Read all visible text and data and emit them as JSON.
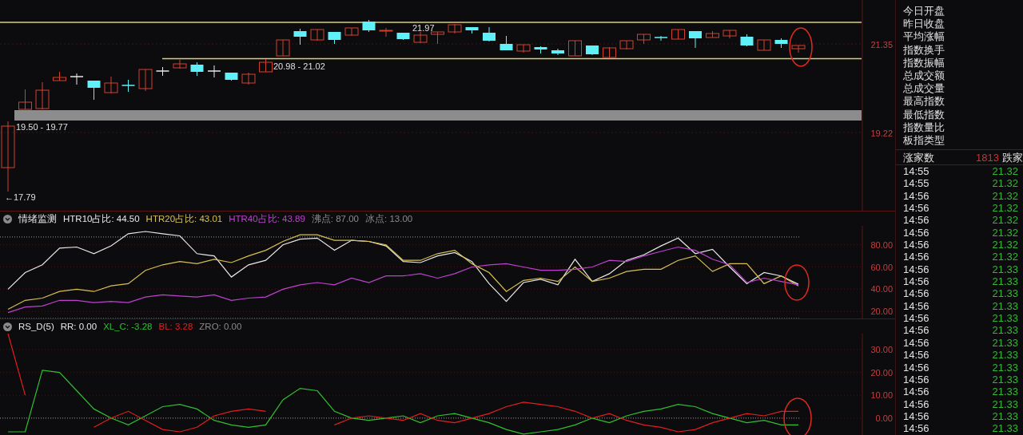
{
  "main_chart": {
    "annotations": [
      {
        "text": "21.97"
      },
      {
        "text": "20.98 - 21.02"
      },
      {
        "text": "19.50 - 19.77"
      },
      {
        "text": "←17.79"
      }
    ],
    "price_labels": [
      "21.35",
      "19.22"
    ]
  },
  "indicators": [
    {
      "title": "情绪监测",
      "legend": [
        {
          "kind": "series"
        },
        {
          "kind": "series"
        },
        {
          "kind": "series"
        },
        {
          "kind": "text",
          "text": "沸点: 87.00",
          "color": "#8a8a8a"
        },
        {
          "kind": "text",
          "text": "冰点: 13.00",
          "color": "#8a8a8a"
        }
      ],
      "chart_data": {
        "type": "line",
        "ylim": [
          13,
          97
        ],
        "grid": true,
        "yticks": [
          {
            "value": 20,
            "label": "20.00"
          },
          {
            "value": 40,
            "label": "40.00"
          },
          {
            "value": 60,
            "label": "60.00"
          },
          {
            "value": 80,
            "label": "80.00"
          }
        ],
        "ref_lines": [
          {
            "axis": "y",
            "value": 87
          },
          {
            "axis": "y",
            "value": 13
          }
        ],
        "series": [
          {
            "name": "HTR10占比: 44.50",
            "color": "#e8e8e8",
            "values": [
              40,
              55,
              62,
              77,
              78,
              72,
              79,
              90,
              92,
              90,
              88,
              72,
              70,
              51,
              62,
              66,
              80,
              85,
              86,
              75,
              84,
              83,
              79,
              65,
              64,
              70,
              73,
              65,
              45,
              29,
              46,
              49,
              44,
              67,
              47,
              54,
              66,
              71,
              79,
              86,
              72,
              76,
              60,
              45,
              55,
              52,
              44.5
            ]
          },
          {
            "name": "HTR20占比: 43.01",
            "color": "#d8c050",
            "values": [
              22,
              30,
              32,
              38,
              40,
              38,
              43,
              45,
              57,
              62,
              65,
              63,
              67,
              64,
              70,
              75,
              83,
              89,
              89,
              84,
              84,
              83,
              80,
              66,
              66,
              72,
              75,
              63,
              55,
              38,
              48,
              50,
              47,
              60,
              47,
              50,
              56,
              58,
              58,
              66,
              70,
              56,
              63,
              63,
              45,
              52,
              43
            ]
          },
          {
            "name": "HTR40占比: 43.89",
            "color": "#c040d0",
            "values": [
              19,
              24,
              25,
              30,
              30,
              28,
              29,
              28,
              33,
              35,
              34,
              33,
              35,
              30,
              32,
              33,
              40,
              44,
              46,
              44,
              50,
              46,
              52,
              52,
              54,
              50,
              54,
              60,
              62,
              63,
              60,
              57,
              57,
              58,
              60,
              66,
              65,
              70,
              74,
              78,
              75,
              67,
              62,
              46,
              50,
              47,
              44
            ]
          }
        ]
      }
    },
    {
      "title": "RS_D(5)",
      "legend": [
        {
          "kind": "text",
          "text": "RR: 0.00",
          "color": "#e8e8e8"
        },
        {
          "kind": "series"
        },
        {
          "kind": "series"
        },
        {
          "kind": "text",
          "text": "ZRO: 0.00",
          "color": "#8a8a8a"
        }
      ],
      "chart_data": {
        "type": "line",
        "ylim": [
          -7.4,
          37
        ],
        "grid": true,
        "yticks": [
          {
            "value": 0,
            "label": "0.00"
          },
          {
            "value": 10,
            "label": "10.00"
          },
          {
            "value": 20,
            "label": "20.00"
          },
          {
            "value": 30,
            "label": "30.00"
          }
        ],
        "ref_lines": [
          {
            "axis": "y",
            "value": 0
          }
        ],
        "series": [
          {
            "name": "XL_C: -3.28",
            "color": "#30c030",
            "values": [
              -6,
              -6,
              21,
              20,
              12,
              4,
              0,
              -3,
              1,
              5,
              6,
              4,
              -1,
              -3,
              -4,
              -3,
              8,
              13,
              12,
              3,
              0,
              -1,
              0,
              1,
              -2,
              1,
              2,
              0,
              -2,
              -5,
              -7,
              -6,
              -5,
              -3,
              0,
              -2,
              1,
              3,
              4,
              6,
              5,
              2,
              0,
              -2,
              -1,
              -3,
              -3
            ]
          },
          {
            "name": "BL: 3.28",
            "color": "#e02020",
            "values": [
              37,
              10,
              null,
              null,
              null,
              -4,
              0,
              3,
              -1,
              -5,
              -6,
              -4,
              1,
              3,
              4,
              3,
              null,
              null,
              null,
              -3,
              0,
              1,
              0,
              -1,
              2,
              -1,
              -2,
              0,
              2,
              5,
              7,
              6,
              5,
              3,
              0,
              2,
              -1,
              -3,
              -4,
              -6,
              -5,
              -2,
              0,
              2,
              1,
              3,
              3
            ]
          }
        ]
      }
    }
  ],
  "quote_panel": {
    "fields": [
      {
        "label": "今日开盘"
      },
      {
        "label": "昨日收盘"
      },
      {
        "label": "平均涨幅"
      },
      {
        "label": "指数换手"
      },
      {
        "label": "指数振幅"
      },
      {
        "label": "总成交额"
      },
      {
        "label": "总成交量"
      },
      {
        "label": "最高指数"
      },
      {
        "label": "最低指数"
      },
      {
        "label": "指数量比"
      },
      {
        "label": "板指类型"
      }
    ],
    "advance": {
      "label": "涨家数",
      "value": "1813",
      "next_label": "跌家"
    }
  },
  "ticks": [
    {
      "time": "14:55",
      "price": "21.32"
    },
    {
      "time": "14:55",
      "price": "21.32"
    },
    {
      "time": "14:56",
      "price": "21.32"
    },
    {
      "time": "14:56",
      "price": "21.32"
    },
    {
      "time": "14:56",
      "price": "21.32"
    },
    {
      "time": "14:56",
      "price": "21.32"
    },
    {
      "time": "14:56",
      "price": "21.32"
    },
    {
      "time": "14:56",
      "price": "21.32"
    },
    {
      "time": "14:56",
      "price": "21.33"
    },
    {
      "time": "14:56",
      "price": "21.33"
    },
    {
      "time": "14:56",
      "price": "21.33"
    },
    {
      "time": "14:56",
      "price": "21.33"
    },
    {
      "time": "14:56",
      "price": "21.33"
    },
    {
      "time": "14:56",
      "price": "21.33"
    },
    {
      "time": "14:56",
      "price": "21.33"
    },
    {
      "time": "14:56",
      "price": "21.33"
    },
    {
      "time": "14:56",
      "price": "21.33"
    },
    {
      "time": "14:56",
      "price": "21.33"
    },
    {
      "time": "14:56",
      "price": "21.33"
    },
    {
      "time": "14:56",
      "price": "21.33"
    },
    {
      "time": "14:56",
      "price": "21.33"
    },
    {
      "time": "14:56",
      "price": "21.33"
    }
  ]
}
